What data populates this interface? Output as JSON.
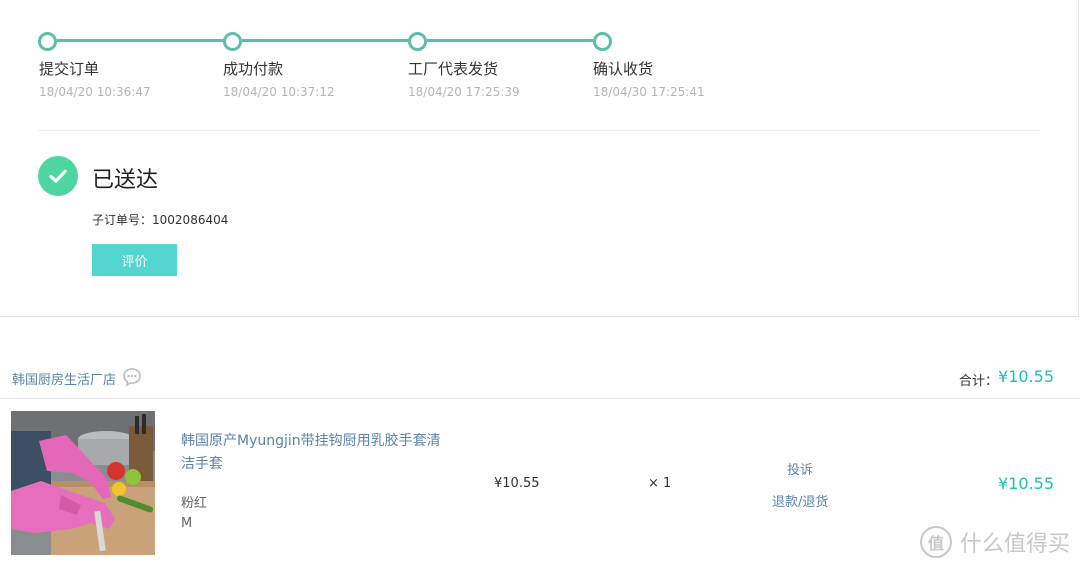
{
  "progress": {
    "steps": [
      {
        "label": "提交订单",
        "time": "18/04/20 10:36:47"
      },
      {
        "label": "成功付款",
        "time": "18/04/20 10:37:12"
      },
      {
        "label": "工厂代表发货",
        "time": "18/04/20 17:25:39"
      },
      {
        "label": "确认收货",
        "time": "18/04/30 17:25:41"
      }
    ]
  },
  "status": {
    "title": "已送达",
    "suborder_label": "子订单号：",
    "suborder_number": "1002086404",
    "review_button": "评价"
  },
  "shop": {
    "name": "韩国厨房生活厂店",
    "total_label": "合计：",
    "total_value": "¥10.55"
  },
  "product": {
    "title": "韩国原产Myungjin带挂钩厨用乳胶手套清洁手套",
    "color": "粉红",
    "size": "M",
    "unit_price": "¥10.55",
    "quantity": "× 1",
    "complain_link": "投诉",
    "refund_link": "退款/退货",
    "row_total": "¥10.55"
  },
  "watermark": {
    "text": "什么值得买",
    "logo_char": "值"
  },
  "colors": {
    "accent_teal": "#5dbfaa",
    "success_green": "#4fd6a0",
    "button_teal": "#52d6cf",
    "price_teal": "#1fbfb8",
    "link_blue": "#5b85a8"
  }
}
